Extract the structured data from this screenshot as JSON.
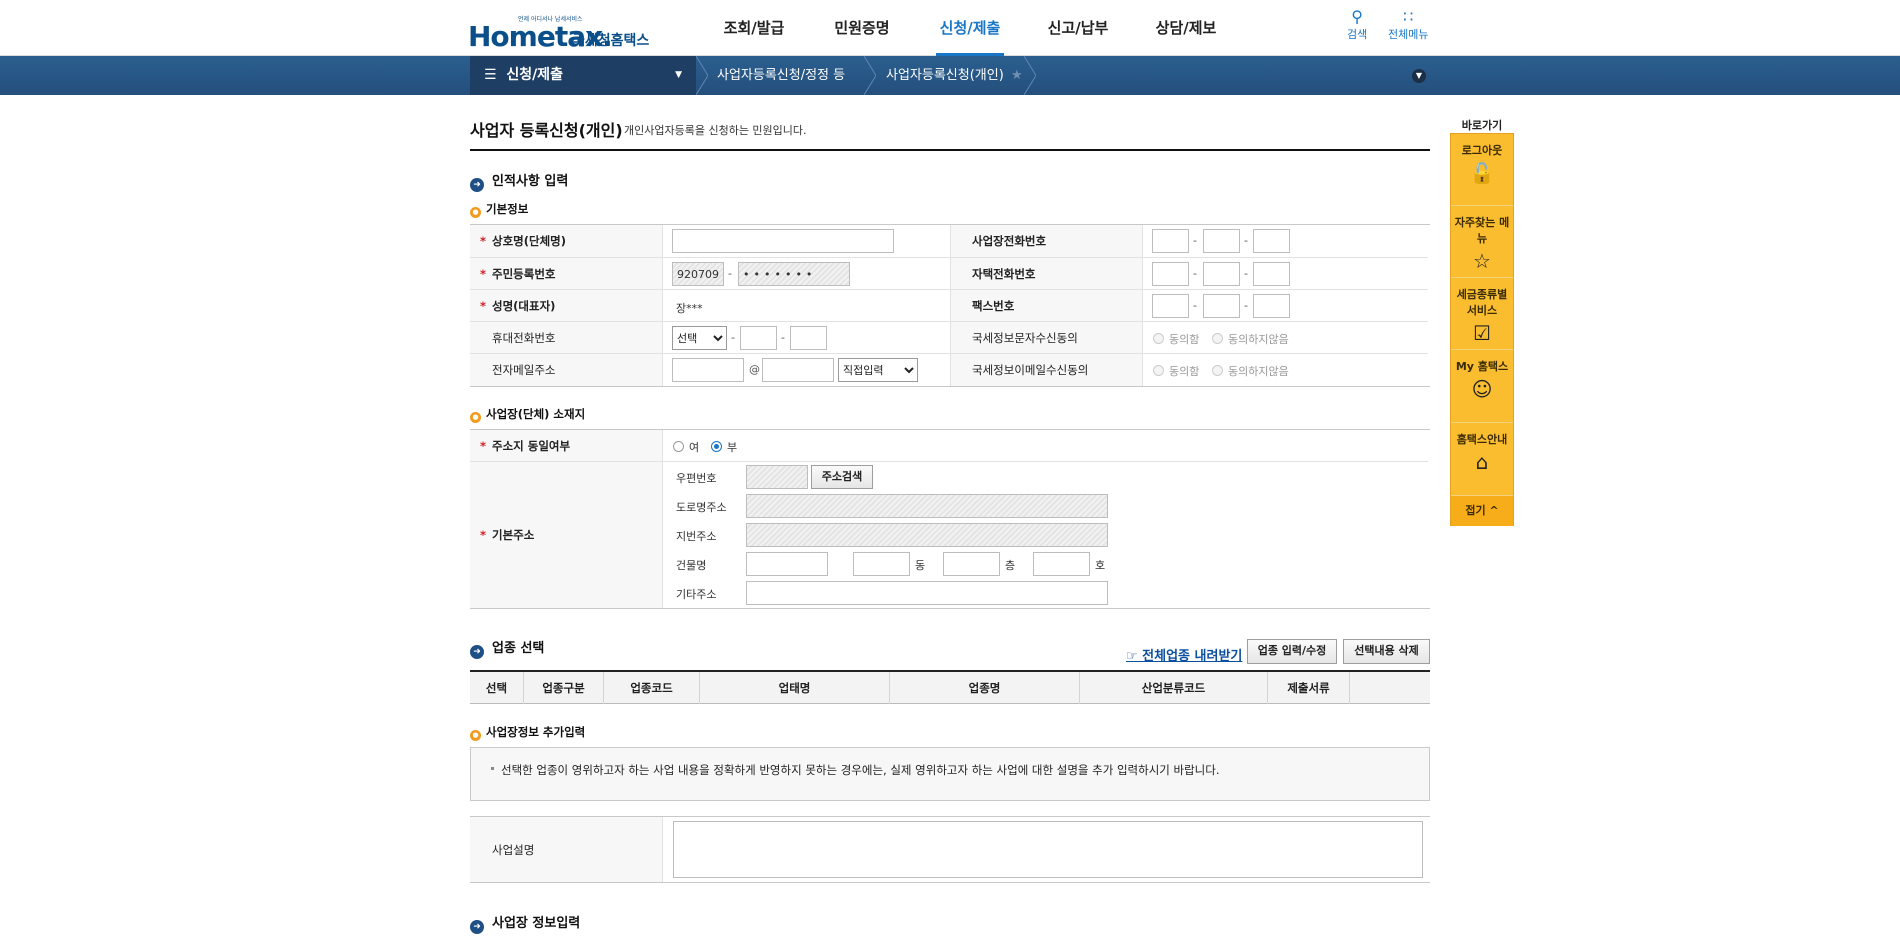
{
  "header": {
    "logo_brand": "Hometax.",
    "logo_tagline": "언제 어디서나 납세서비스",
    "logo_sub": "국세청홈택스",
    "nav": [
      "조회/발급",
      "민원증명",
      "신청/제출",
      "신고/납부",
      "상담/제보"
    ],
    "active_nav": "신청/제출",
    "search_label": "검색",
    "allmenu_label": "전체메뉴",
    "accent_color": "#1976c5"
  },
  "locbar": {
    "menu_label": "신청/제출",
    "crumb1": "사업자등록신청/정정 등",
    "crumb2": "사업자등록신청(개인)"
  },
  "page": {
    "title": "사업자 등록신청(개인)",
    "desc": "개인사업자등록을 신청하는 민원입니다."
  },
  "personal": {
    "heading": "인적사항 입력",
    "sub_heading": "기본정보",
    "trade_name_label": "상호명(단체명)",
    "rrn_label": "주민등록번호",
    "rrn_front": "920709",
    "rrn_back": "•••••••",
    "name_label": "성명(대표자)",
    "name_value": "장***",
    "mobile_label": "휴대전화번호",
    "mobile_select": "선택",
    "email_label": "전자메일주소",
    "email_at": "@",
    "email_domain_select": "직접입력",
    "biz_phone_label": "사업장전화번호",
    "home_phone_label": "자택전화번호",
    "fax_label": "팩스번호",
    "sms_consent_label": "국세정보문자수신동의",
    "email_consent_label": "국세정보이메일수신동의",
    "agree": "동의함",
    "disagree": "동의하지않음"
  },
  "address": {
    "sub_heading": "사업장(단체) 소재지",
    "same_label": "주소지 동일여부",
    "yes": "여",
    "no": "부",
    "basic_label": "기본주소",
    "zip_label": "우편번호",
    "search_button": "주소검색",
    "road_label": "도로명주소",
    "jibun_label": "지번주소",
    "building_label": "건물명",
    "dong": "동",
    "floor": "층",
    "ho": "호",
    "etc_label": "기타주소"
  },
  "industry": {
    "heading": "업종 선택",
    "download_link": "☞ 전체업종 내려받기",
    "edit_button": "업종 입력/수정",
    "delete_button": "선택내용 삭제",
    "columns": [
      "선택",
      "업종구분",
      "업종코드",
      "업태명",
      "업종명",
      "산업분류코드",
      "제출서류"
    ]
  },
  "extra": {
    "sub_heading": "사업장정보 추가입력",
    "notice": "선택한 업종이 영위하고자 하는 사업 내용을 정확하게 반영하지 못하는 경우에는, 실제 영위하고자 하는 사업에 대한 설명을 추가 입력하시기 바랍니다.",
    "desc_label": "사업설명"
  },
  "next_section": "사업장 정보입력",
  "quick": {
    "title": "바로가기",
    "items": [
      "로그아웃",
      "자주찾는 메뉴",
      "세금종류별 서비스",
      "My 홈택스",
      "홈택스안내"
    ],
    "icons": [
      "unlock-icon",
      "star-icon",
      "checkbox-icon",
      "person-icon",
      "home-icon"
    ],
    "fold": "접기 ^"
  }
}
